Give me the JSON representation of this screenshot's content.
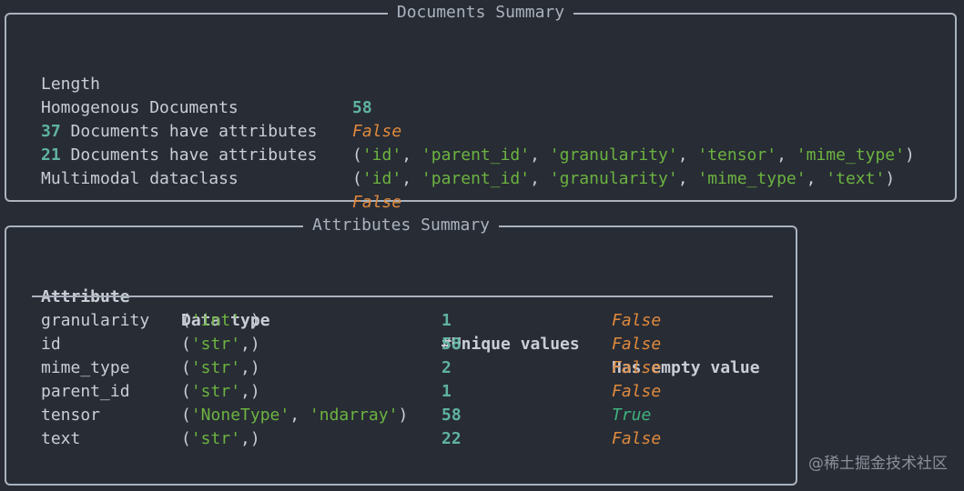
{
  "documents_summary": {
    "title": "Documents Summary",
    "length_label": "Length",
    "length_value": "58",
    "homogenous_label": "Homogenous Documents",
    "homogenous_value": "False",
    "group1_count": "37",
    "group1_label": " Documents have attributes",
    "group1_attrs": [
      "'id'",
      "'parent_id'",
      "'granularity'",
      "'tensor'",
      "'mime_type'"
    ],
    "group2_count": "21",
    "group2_label": " Documents have attributes",
    "group2_attrs": [
      "'id'",
      "'parent_id'",
      "'granularity'",
      "'mime_type'",
      "'text'"
    ],
    "multimodal_label": "Multimodal dataclass",
    "multimodal_value": "False"
  },
  "attributes_summary": {
    "title": "Attributes Summary",
    "headers": {
      "attribute": "Attribute",
      "data_type": "Data type",
      "unique": "#Unique values",
      "empty": "Has empty value"
    },
    "rows": [
      {
        "attribute": "granularity",
        "types": [
          "'int'"
        ],
        "unique": "1",
        "empty": "False"
      },
      {
        "attribute": "id",
        "types": [
          "'str'"
        ],
        "unique": "58",
        "empty": "False"
      },
      {
        "attribute": "mime_type",
        "types": [
          "'str'"
        ],
        "unique": "2",
        "empty": "False"
      },
      {
        "attribute": "parent_id",
        "types": [
          "'str'"
        ],
        "unique": "1",
        "empty": "False"
      },
      {
        "attribute": "tensor",
        "types": [
          "'NoneType'",
          "'ndarray'"
        ],
        "unique": "58",
        "empty": "True"
      },
      {
        "attribute": "text",
        "types": [
          "'str'"
        ],
        "unique": "22",
        "empty": "False"
      }
    ]
  },
  "watermark": "@稀土掘金技术社区",
  "colors": {
    "background": "#282c35",
    "border": "#aab3be",
    "number": "#5fb3a1",
    "false": "#e08a3c",
    "true": "#3fb27f",
    "string": "#6cb340"
  }
}
